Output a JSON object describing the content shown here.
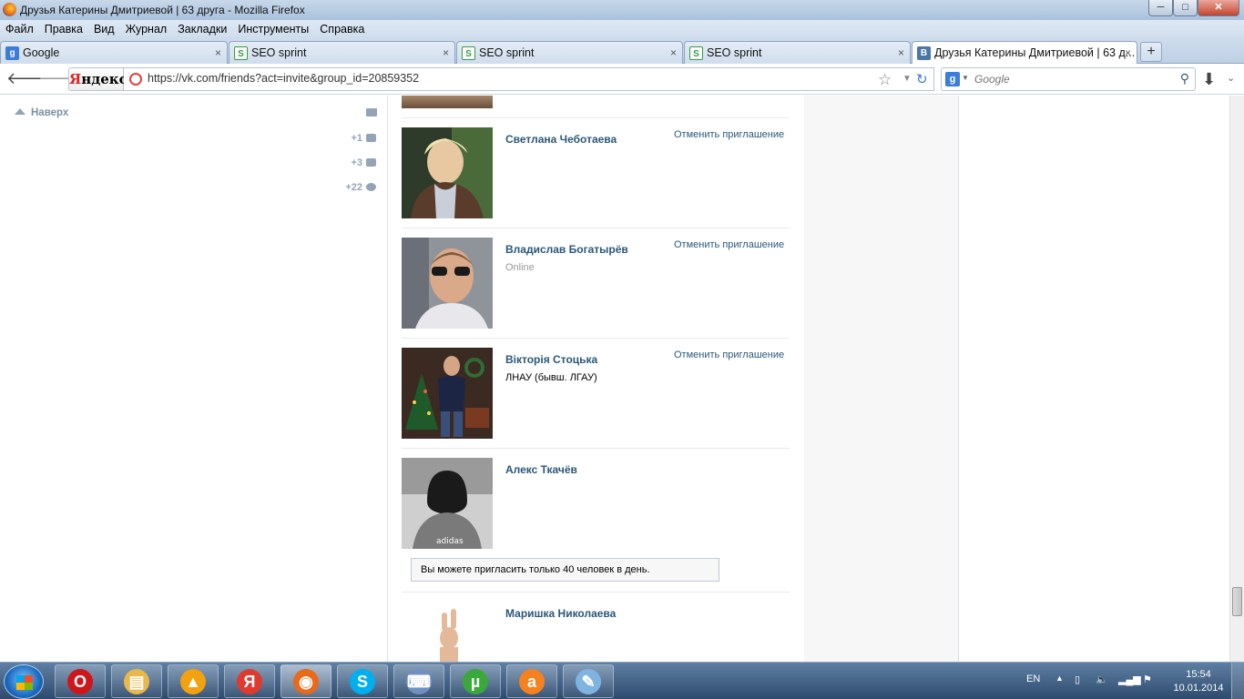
{
  "window": {
    "title": "Друзья Катерины Дмитриевой | 63 друга - Mozilla Firefox",
    "minimize": "─",
    "maximize": "□",
    "close": "✕"
  },
  "menu": [
    "Файл",
    "Правка",
    "Вид",
    "Журнал",
    "Закладки",
    "Инструменты",
    "Справка"
  ],
  "tabs": [
    {
      "label": "Google",
      "icon": "g"
    },
    {
      "label": "SEO sprint",
      "icon": "S"
    },
    {
      "label": "SEO sprint",
      "icon": "S"
    },
    {
      "label": "SEO sprint",
      "icon": "S"
    },
    {
      "label": "Друзья Катерины Дмитриевой | 63 д...",
      "icon": "В"
    }
  ],
  "tab_close": "×",
  "tab_add": "+",
  "nav": {
    "back": "🡐",
    "forward": "🡒",
    "yandex_logo_ya": "Я",
    "yandex_logo_rest": "ндекс",
    "url": "https://vk.com/friends?act=invite&group_id=20859352",
    "star": "☆",
    "drop": "▼",
    "reload": "↻",
    "search_placeholder": "Google",
    "search_engine": "g",
    "search_drop": "▼",
    "search_icon": "⚲",
    "download": "⬇",
    "menu_arrow": "⌄"
  },
  "sidebar": {
    "up_link": "Наверх",
    "counters": [
      "+1",
      "+3",
      "+22"
    ]
  },
  "people": [
    {
      "name": "Светлана Чеботаева",
      "sub": "",
      "cancel": "Отменить приглашение"
    },
    {
      "name": "Владислав Богатырёв",
      "sub": "Online",
      "cancel": "Отменить приглашение"
    },
    {
      "name": "Вікторія Стоцька",
      "sub": "ЛНАУ (бывш. ЛГАУ)",
      "cancel": "Отменить приглашение"
    },
    {
      "name": "Алекс Ткачёв",
      "sub": "",
      "cancel": ""
    },
    {
      "name": "Маришка Николаева",
      "sub": "",
      "cancel": ""
    }
  ],
  "notice": "Вы можете пригласить только 40 человек в день.",
  "taskbar": {
    "apps": [
      {
        "name": "opera",
        "glyph": "O",
        "color": "#d0161a"
      },
      {
        "name": "explorer",
        "glyph": "▤",
        "color": "#e8b84a"
      },
      {
        "name": "aimp",
        "glyph": "▲",
        "color": "#f3a10f"
      },
      {
        "name": "yandex-browser",
        "glyph": "Я",
        "color": "#e03a2f"
      },
      {
        "name": "firefox",
        "glyph": "◉",
        "color": "#e86a1a"
      },
      {
        "name": "skype",
        "glyph": "S",
        "color": "#00aff0"
      },
      {
        "name": "keyboard",
        "glyph": "⌨",
        "color": "#7090c0"
      },
      {
        "name": "utorrent",
        "glyph": "µ",
        "color": "#3aa83a"
      },
      {
        "name": "avast",
        "glyph": "a",
        "color": "#f5811f"
      },
      {
        "name": "notepad",
        "glyph": "✎",
        "color": "#7fb4e0"
      }
    ],
    "lang": "EN",
    "time": "15:54",
    "date": "10.01.2014"
  }
}
